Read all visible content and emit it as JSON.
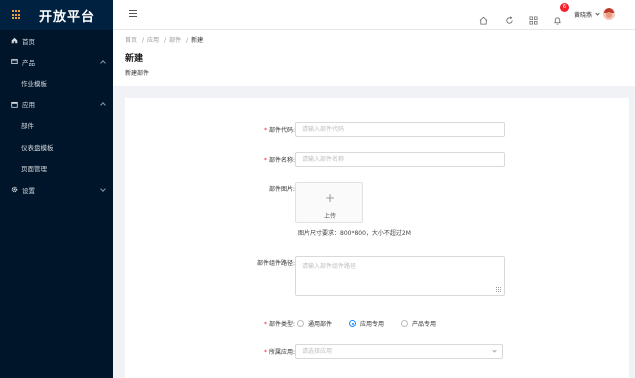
{
  "app": {
    "title": "开放平台"
  },
  "sidebar": {
    "items": [
      {
        "label": "首页",
        "icon": "home-icon"
      },
      {
        "label": "产品",
        "icon": "product-icon"
      },
      {
        "label": "作业模板"
      },
      {
        "label": "应用",
        "icon": "calendar-icon"
      },
      {
        "label": "部件"
      },
      {
        "label": "仪表盘模板"
      },
      {
        "label": "页面管理"
      },
      {
        "label": "设置",
        "icon": "gear-icon"
      }
    ]
  },
  "header": {
    "notification_count": "6",
    "username": "黄晓燕"
  },
  "breadcrumb": [
    "首页",
    "应用",
    "部件",
    "新建"
  ],
  "page": {
    "title": "新建",
    "subtitle": "新建部件"
  },
  "form": {
    "code": {
      "label": "部件代码:",
      "placeholder": "请输入部件代码"
    },
    "name": {
      "label": "部件名称:",
      "placeholder": "请输入部件名称"
    },
    "image": {
      "label": "部件图片:",
      "upload_label": "上传",
      "hint": "图片尺寸要求：800*800，大小不超过2M"
    },
    "path": {
      "label": "部件组件路径:",
      "placeholder": "请输入部件组件路径"
    },
    "type": {
      "label": "部件类型:",
      "options": [
        "通用部件",
        "应用专用",
        "产品专用"
      ],
      "selected": "应用专用"
    },
    "app": {
      "label": "所属应用:",
      "placeholder": "请选择应用"
    }
  },
  "colors": {
    "sidebar_bg": "#001529",
    "accent": "#1890ff",
    "required": "#f5222d"
  }
}
